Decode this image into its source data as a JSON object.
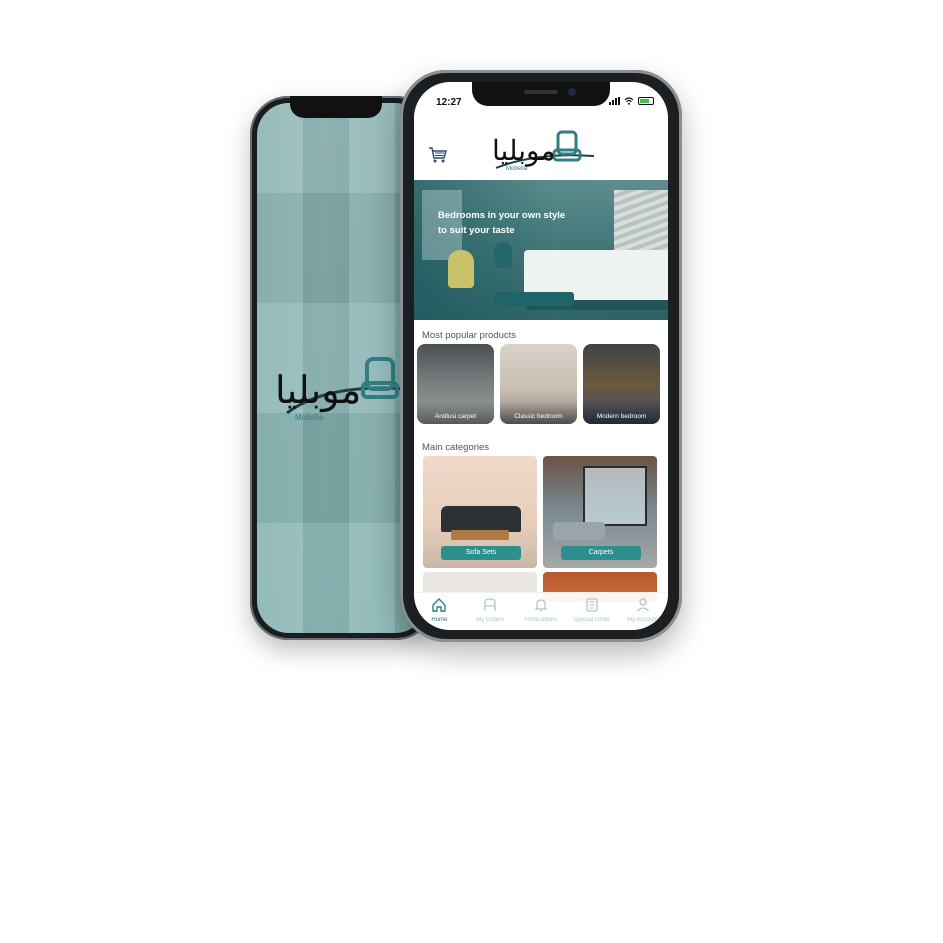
{
  "status_bar": {
    "time": "12:27"
  },
  "brand": {
    "logo_arabic": "موبليا",
    "logo_latin": "Mobelia"
  },
  "icons": {
    "cart": "cart-icon",
    "chair": "armchair-icon"
  },
  "hero": {
    "text_line1": "Bedrooms in your own style",
    "text_line2": "to suit your taste"
  },
  "popular": {
    "title": "Most popular products",
    "items": [
      {
        "label": "Andlusi carpet"
      },
      {
        "label": "Classic bedroom"
      },
      {
        "label": "Modern bedroom"
      }
    ]
  },
  "categories": {
    "title": "Main categories",
    "items": [
      {
        "label": "Sofa Sets"
      },
      {
        "label": "Carpets"
      }
    ]
  },
  "bottom_nav": {
    "items": [
      {
        "label": "Home",
        "icon": "home-icon",
        "active": true
      },
      {
        "label": "My Orders",
        "icon": "orders-icon",
        "active": false
      },
      {
        "label": "Notifications",
        "icon": "bell-icon",
        "active": false
      },
      {
        "label": "Special Order",
        "icon": "document-icon",
        "active": false
      },
      {
        "label": "My Account",
        "icon": "user-icon",
        "active": false
      }
    ]
  },
  "colors": {
    "accent": "#2e8f8f",
    "teal_dark": "#1f5659",
    "nav_inactive": "#aac8c8"
  }
}
